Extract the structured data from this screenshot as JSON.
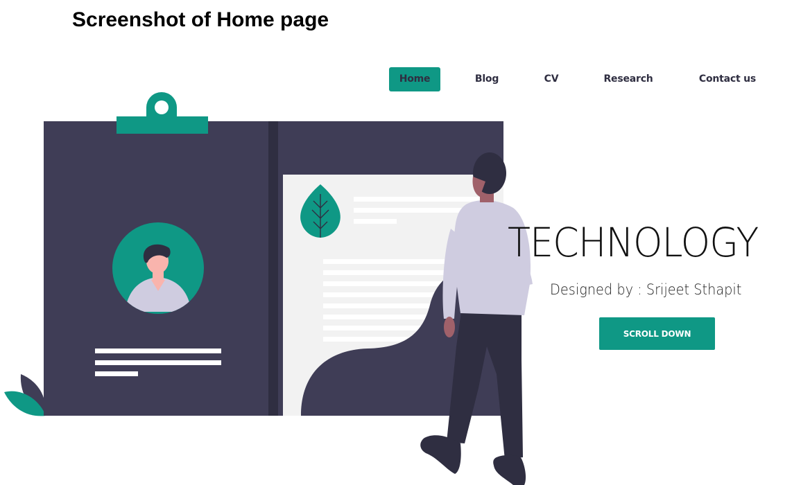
{
  "caption": "Screenshot of Home page",
  "nav": {
    "items": [
      {
        "label": "Home",
        "active": true
      },
      {
        "label": "Blog",
        "active": false
      },
      {
        "label": "CV",
        "active": false
      },
      {
        "label": "Research",
        "active": false
      },
      {
        "label": "Contact us",
        "active": false
      }
    ]
  },
  "hero": {
    "title": "TECHNOLOGY",
    "subtitle": "Designed by : Srijeet Sthapit",
    "cta_label": "SCROLL DOWN"
  },
  "illustration": {
    "name": "resume-illustration",
    "colors": {
      "accent": "#0f9885",
      "dark": "#3f3d56",
      "darker": "#2f2e41",
      "paper": "#f2f2f2",
      "sweater": "#cfcce0",
      "skin": "#f9b4ad"
    }
  }
}
